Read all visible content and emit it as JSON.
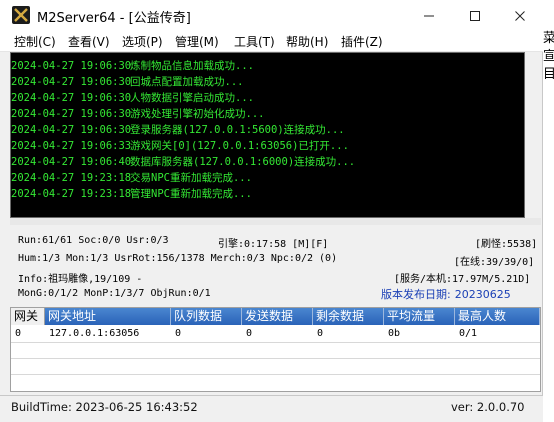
{
  "window": {
    "title": "M2Server64 - [公益传奇]",
    "controls": {
      "minimize": "—",
      "maximize": "☐",
      "close": "✕"
    }
  },
  "menu": [
    "控制(C)",
    "查看(V)",
    "选项(P)",
    "管理(M)",
    "工具(T)",
    "帮助(H)",
    "插件(Z)"
  ],
  "log": [
    {
      "time": "2024-04-27 19:06:30",
      "msg": "炼制物品信息加载成功..."
    },
    {
      "time": "2024-04-27 19:06:30",
      "msg": "回城点配置加载成功..."
    },
    {
      "time": "2024-04-27 19:06:30",
      "msg": "人物数据引擎启动成功..."
    },
    {
      "time": "2024-04-27 19:06:30",
      "msg": "游戏处理引擎初始化成功..."
    },
    {
      "time": "2024-04-27 19:06:30",
      "msg": "登录服务器(127.0.0.1:5600)连接成功..."
    },
    {
      "time": "2024-04-27 19:06:33",
      "msg": "游戏网关[0](127.0.0.1:63056)已打开..."
    },
    {
      "time": "2024-04-27 19:06:40",
      "msg": "数据库服务器(127.0.0.1:6000)连接成功..."
    },
    {
      "time": "2024-04-27 19:23:18",
      "msg": "交易NPC重新加载完成..."
    },
    {
      "time": "2024-04-27 19:23:18",
      "msg": "管理NPC重新加载完成..."
    }
  ],
  "stats": {
    "run": "Run:61/61 Soc:0/0 Usr:0/3",
    "engine": "引擎:0:17:58 [M][F]",
    "refresh": "[刷怪:5538]",
    "hum": "Hum:1/3 Mon:1/3 UsrRot:156/1378 Merch:0/3 Npc:0/2 (0)",
    "online": "[在线:39/39/0]",
    "info": "Info:祖玛雕像,19/109 -",
    "server_native": "[服务/本机:17.97M/5.21D]",
    "mong": "MonG:0/1/2 MonP:1/3/7 ObjRun:0/1",
    "release_label": "版本发布日期:",
    "release_date": "20230625"
  },
  "gateway_table": {
    "columns": [
      "网关",
      "网关地址",
      "队列数据",
      "发送数据",
      "剩余数据",
      "平均流量",
      "最高人数"
    ],
    "rows": [
      [
        "0",
        "127.0.0.1:63056",
        "0",
        "0",
        "0",
        "0b",
        "0/1"
      ]
    ]
  },
  "statusbar": {
    "build": "BuildTime:  2023-06-25 16:43:52",
    "version": "ver:  2.0.0.70"
  },
  "side_glyphs": [
    "菜",
    "宣",
    "目"
  ]
}
